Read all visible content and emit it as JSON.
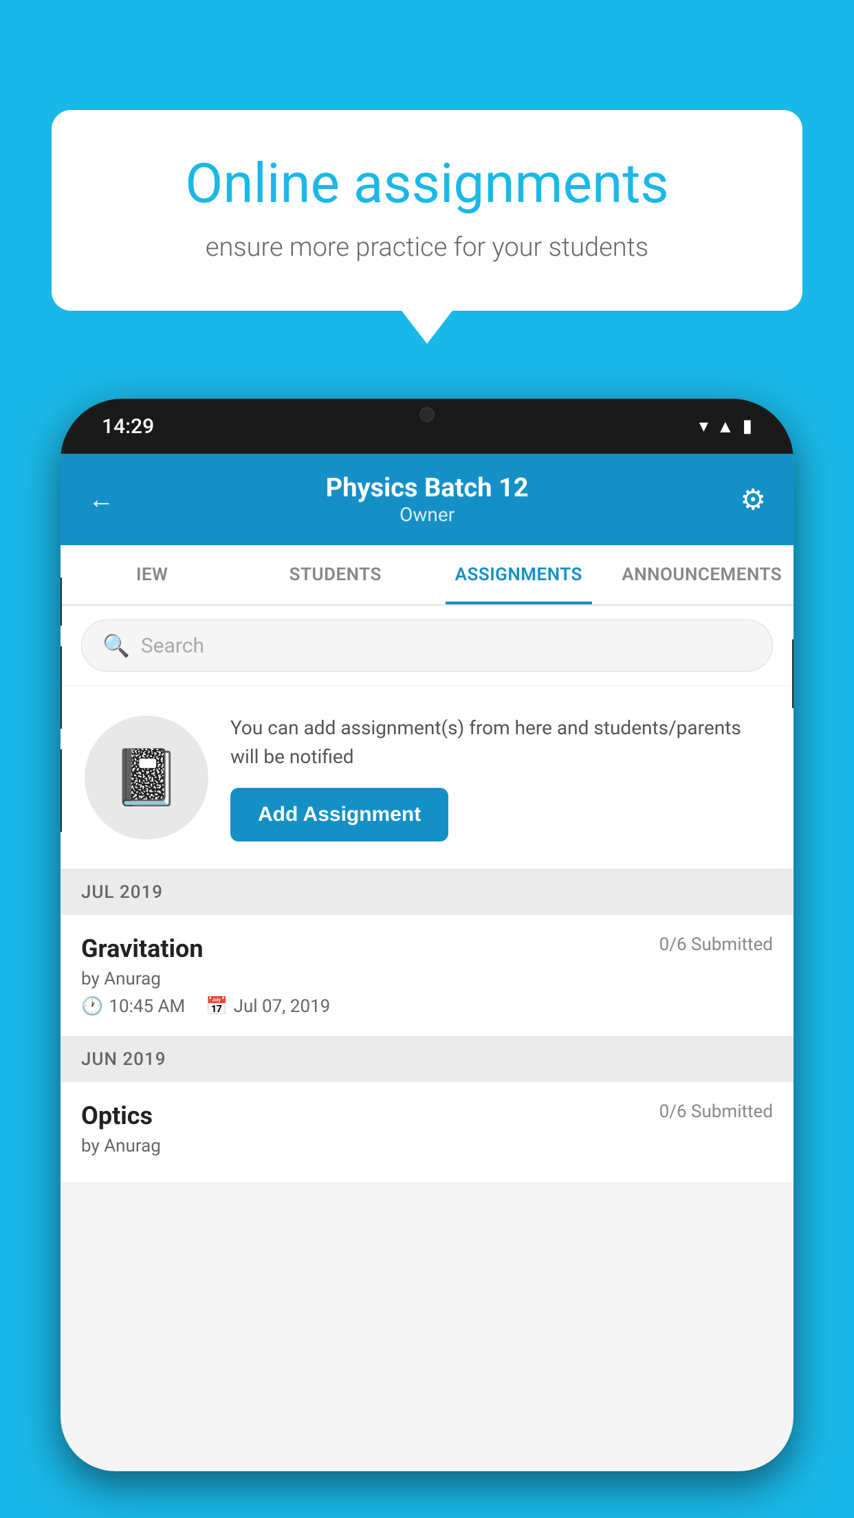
{
  "background_color": "#1ab8e8",
  "speech_bubble": {
    "title": "Online assignments",
    "subtitle": "ensure more practice for your students"
  },
  "phone": {
    "time": "14:29",
    "header": {
      "title": "Physics Batch 12",
      "subtitle": "Owner",
      "back_label": "←",
      "settings_label": "⚙"
    },
    "tabs": [
      {
        "label": "IEW",
        "active": false
      },
      {
        "label": "STUDENTS",
        "active": false
      },
      {
        "label": "ASSIGNMENTS",
        "active": true
      },
      {
        "label": "ANNOUNCEMENTS",
        "active": false
      }
    ],
    "search": {
      "placeholder": "Search"
    },
    "promo": {
      "text": "You can add assignment(s) from here and students/parents will be notified",
      "button_label": "Add Assignment"
    },
    "sections": [
      {
        "label": "JUL 2019",
        "assignments": [
          {
            "name": "Gravitation",
            "submitted": "0/6 Submitted",
            "by": "by Anurag",
            "time": "10:45 AM",
            "date": "Jul 07, 2019"
          }
        ]
      },
      {
        "label": "JUN 2019",
        "assignments": [
          {
            "name": "Optics",
            "submitted": "0/6 Submitted",
            "by": "by Anurag",
            "time": "",
            "date": ""
          }
        ]
      }
    ]
  }
}
